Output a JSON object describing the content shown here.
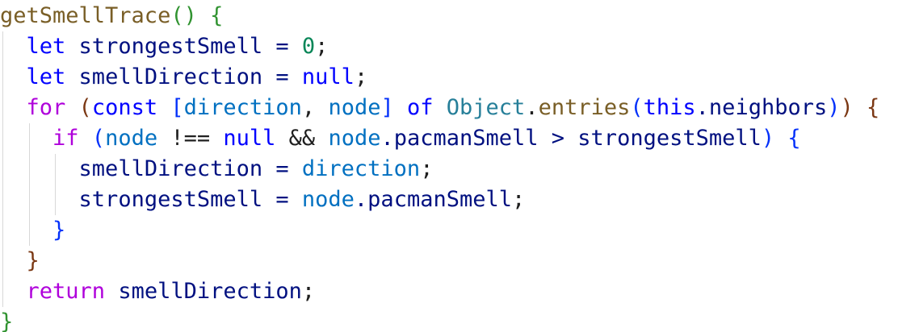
{
  "code_lines": [
    {
      "indent": "",
      "tokens": [
        {
          "text": "getSmellTrace",
          "kind": "fn"
        },
        {
          "text": "() {",
          "kind": "b1"
        }
      ]
    },
    {
      "indent": "  ",
      "tokens": [
        {
          "text": "let",
          "kind": "kw"
        },
        {
          "text": " strongestSmell = ",
          "kind": "var"
        },
        {
          "text": "0",
          "kind": "num"
        },
        {
          "text": ";",
          "kind": "plain"
        }
      ]
    },
    {
      "indent": "  ",
      "tokens": [
        {
          "text": "let",
          "kind": "kw"
        },
        {
          "text": " smellDirection = ",
          "kind": "var"
        },
        {
          "text": "null",
          "kind": "kw"
        },
        {
          "text": ";",
          "kind": "plain"
        }
      ]
    },
    {
      "indent": "  ",
      "tokens": [
        {
          "text": "for",
          "kind": "ctl"
        },
        {
          "text": " (",
          "kind": "b2"
        },
        {
          "text": "const",
          "kind": "kw"
        },
        {
          "text": " [",
          "kind": "b3"
        },
        {
          "text": "direction",
          "kind": "param"
        },
        {
          "text": ", ",
          "kind": "plain"
        },
        {
          "text": "node",
          "kind": "param"
        },
        {
          "text": "]",
          "kind": "b3"
        },
        {
          "text": " of ",
          "kind": "kw"
        },
        {
          "text": "Object",
          "kind": "type"
        },
        {
          "text": ".",
          "kind": "plain"
        },
        {
          "text": "entries",
          "kind": "fn"
        },
        {
          "text": "(",
          "kind": "b3"
        },
        {
          "text": "this",
          "kind": "kw"
        },
        {
          "text": ".neighbors",
          "kind": "var"
        },
        {
          "text": ")",
          "kind": "b3"
        },
        {
          "text": ")",
          "kind": "b2"
        },
        {
          "text": " {",
          "kind": "b2"
        }
      ]
    },
    {
      "indent": "    ",
      "tokens": [
        {
          "text": "if",
          "kind": "ctl"
        },
        {
          "text": " (",
          "kind": "b3"
        },
        {
          "text": "node",
          "kind": "param"
        },
        {
          "text": " !== ",
          "kind": "plain"
        },
        {
          "text": "null",
          "kind": "kw"
        },
        {
          "text": " && ",
          "kind": "plain"
        },
        {
          "text": "node",
          "kind": "param"
        },
        {
          "text": ".pacmanSmell > strongestSmell",
          "kind": "var"
        },
        {
          "text": ")",
          "kind": "b3"
        },
        {
          "text": " {",
          "kind": "b3"
        }
      ]
    },
    {
      "indent": "      ",
      "tokens": [
        {
          "text": "smellDirection = ",
          "kind": "var"
        },
        {
          "text": "direction",
          "kind": "param"
        },
        {
          "text": ";",
          "kind": "plain"
        }
      ]
    },
    {
      "indent": "      ",
      "tokens": [
        {
          "text": "strongestSmell = ",
          "kind": "var"
        },
        {
          "text": "node",
          "kind": "param"
        },
        {
          "text": ".pacmanSmell",
          "kind": "var"
        },
        {
          "text": ";",
          "kind": "plain"
        }
      ]
    },
    {
      "indent": "    ",
      "tokens": [
        {
          "text": "}",
          "kind": "b3"
        }
      ]
    },
    {
      "indent": "  ",
      "tokens": [
        {
          "text": "}",
          "kind": "b2"
        }
      ]
    },
    {
      "indent": "  ",
      "tokens": [
        {
          "text": "return",
          "kind": "ctl"
        },
        {
          "text": " smellDirection",
          "kind": "var"
        },
        {
          "text": ";",
          "kind": "plain"
        }
      ]
    },
    {
      "indent": "",
      "tokens": [
        {
          "text": "}",
          "kind": "b1"
        }
      ]
    }
  ],
  "syntax_colors": {
    "function": "#795e26",
    "keyword": "#0000ff",
    "control": "#af00db",
    "variable": "#001080",
    "parameter": "#0070c1",
    "number": "#098658",
    "type": "#267f99",
    "plain": "#1f1f1f",
    "bracket_level_1": "#319331",
    "bracket_level_2": "#7b3814",
    "bracket_level_3": "#0431fa"
  }
}
